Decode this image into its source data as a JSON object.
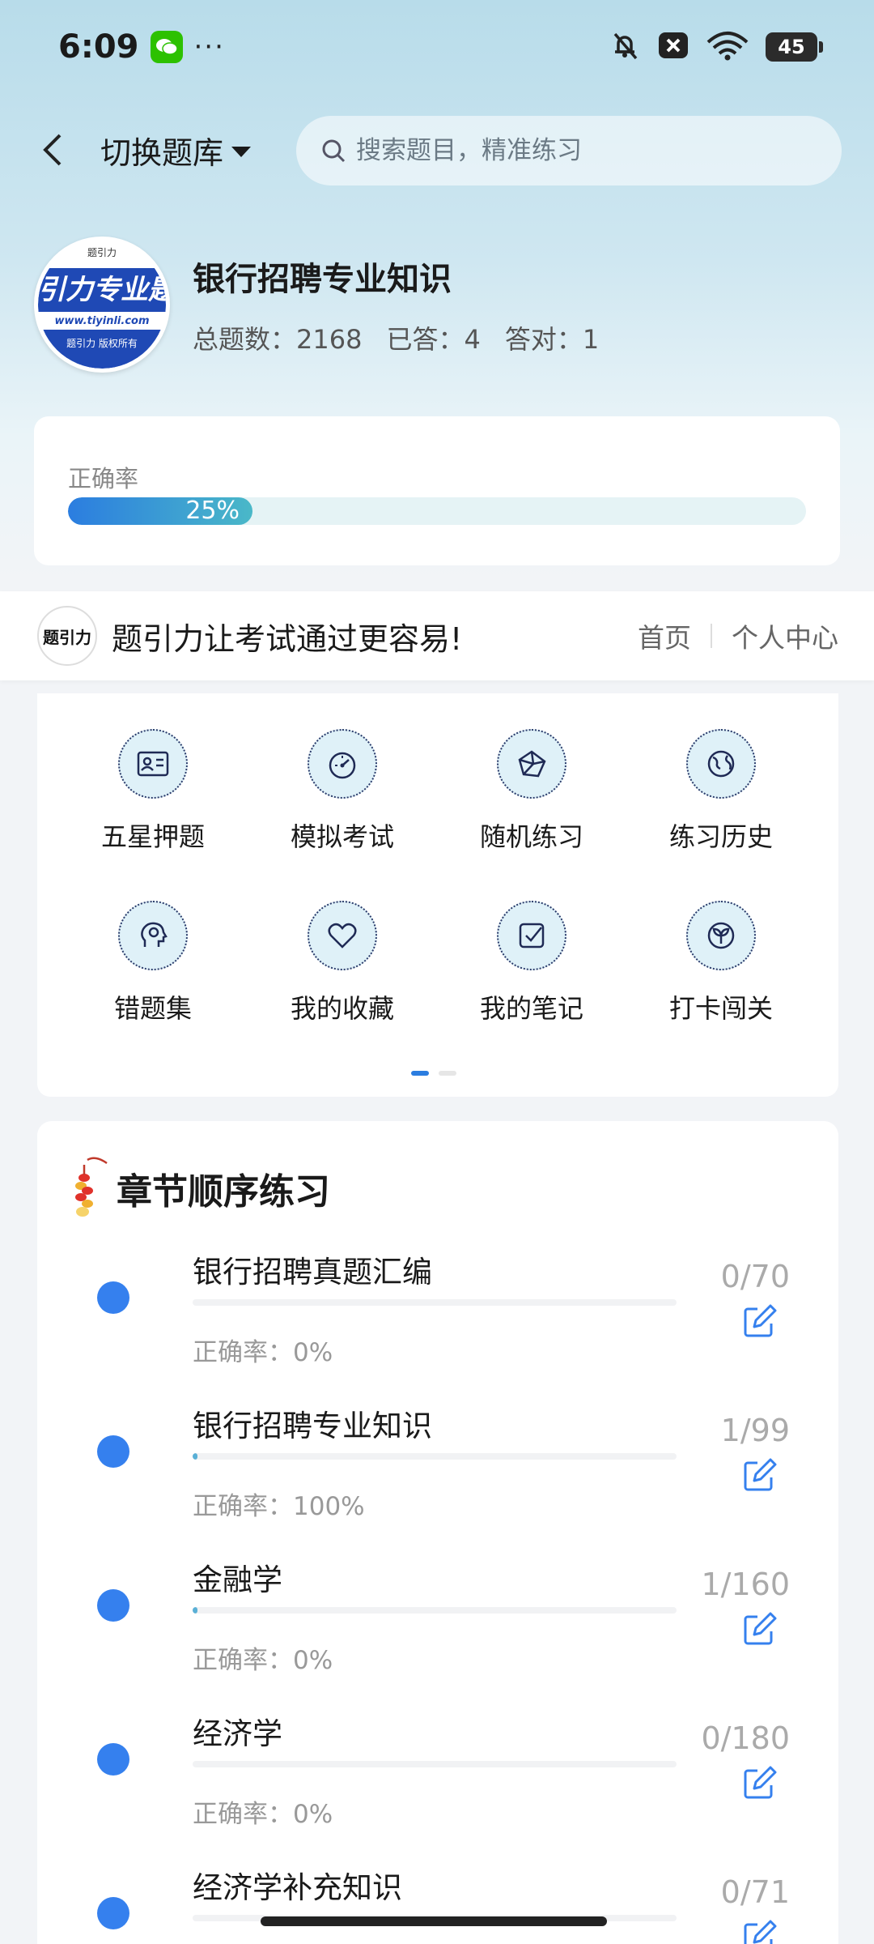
{
  "status_bar": {
    "time": "6:09",
    "more": "···",
    "battery": "45"
  },
  "nav": {
    "switch_label": "切换题库",
    "search_placeholder": "搜索题目，精准练习"
  },
  "bank": {
    "logo_top": "题引力",
    "logo_band": "引力专业题",
    "logo_url": "www.tiyinli.com",
    "logo_foot": "题引力 版权所有",
    "title": "银行招聘专业知识",
    "total": "总题数：2168",
    "answered": "已答：4",
    "correct": "答对：1"
  },
  "accuracy": {
    "label": "正确率",
    "value_text": "25%",
    "value": 0.25
  },
  "promo": {
    "logo_text": "题引力",
    "text": "题引力让考试通过更容易!",
    "home": "首页",
    "profile": "个人中心"
  },
  "grid": {
    "items": [
      {
        "label": "五星押题",
        "icon": "id-card-icon"
      },
      {
        "label": "模拟考试",
        "icon": "speedometer-icon"
      },
      {
        "label": "随机练习",
        "icon": "network-icon"
      },
      {
        "label": "练习历史",
        "icon": "globe-icon"
      },
      {
        "label": "错题集",
        "icon": "head-icon"
      },
      {
        "label": "我的收藏",
        "icon": "heart-icon"
      },
      {
        "label": "我的笔记",
        "icon": "note-check-icon"
      },
      {
        "label": "打卡闯关",
        "icon": "leaf-icon"
      }
    ],
    "page": 1,
    "pages": 2
  },
  "chapters": {
    "title": "章节顺序练习",
    "items": [
      {
        "name": "银行招聘真题汇编",
        "accuracy": "正确率：0%",
        "count": "0/70",
        "progress": 0
      },
      {
        "name": "银行招聘专业知识",
        "accuracy": "正确率：100%",
        "count": "1/99",
        "progress": 0.0101
      },
      {
        "name": "金融学",
        "accuracy": "正确率：0%",
        "count": "1/160",
        "progress": 0.00625
      },
      {
        "name": "经济学",
        "accuracy": "正确率：0%",
        "count": "0/180",
        "progress": 0
      },
      {
        "name": "经济学补充知识",
        "accuracy": "",
        "count": "0/71",
        "progress": 0
      }
    ]
  },
  "colors": {
    "accent": "#2b7de0",
    "dot": "#3580ee",
    "teal": "#4ab8c8"
  }
}
